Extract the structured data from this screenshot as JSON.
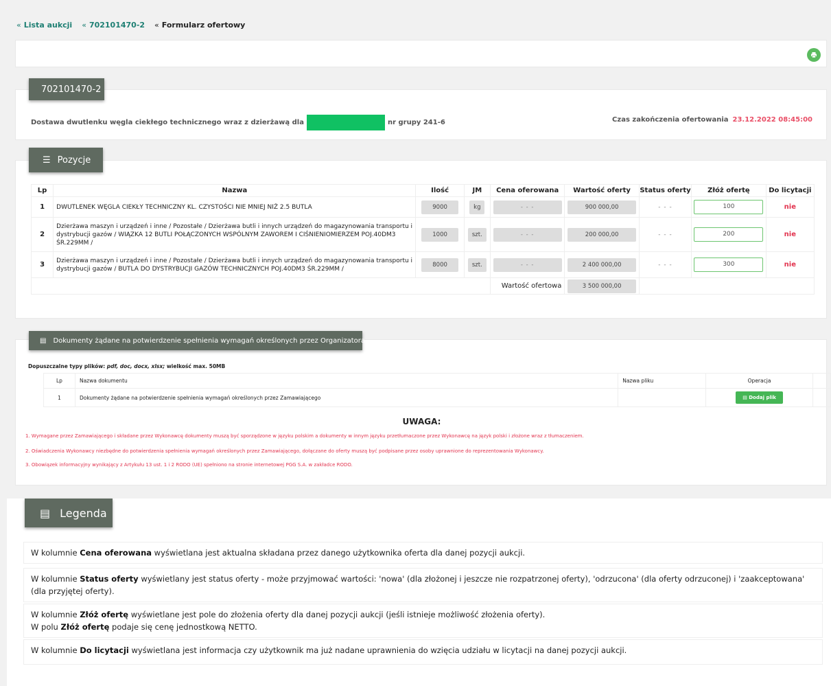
{
  "breadcrumb": [
    {
      "label": "Lista aukcji"
    },
    {
      "label": "702101470-2"
    },
    {
      "label": "Formularz ofertowy"
    }
  ],
  "toolbar": {
    "print_icon": "print-icon"
  },
  "auction": {
    "id": "702101470-2",
    "description_pre": "Dostawa dwutlenku węgla ciekłego technicznego wraz z dzierżawą dla",
    "description_post": "nr grupy 241-6",
    "deadline_label": "Czas zakończenia ofertowania",
    "deadline_value": "23.12.2022 08:45:00"
  },
  "positions": {
    "tab_label": "Pozycje",
    "columns": [
      "Lp",
      "Nazwa",
      "Ilość",
      "JM",
      "Cena oferowana",
      "Wartość oferty",
      "Status oferty",
      "Złóż ofertę",
      "Do licytacji"
    ],
    "rows": [
      {
        "lp": "1",
        "name": "DWUTLENEK WĘGLA CIEKŁY TECHNICZNY KL. CZYSTOŚCI NIE MNIEJ NIŻ 2.5 BUTLA",
        "qty": "9000",
        "unit": "kg",
        "price": "- - -",
        "value": "900 000,00",
        "status": "- - -",
        "offer": "100",
        "auction": "nie"
      },
      {
        "lp": "2",
        "name": "Dzierżawa maszyn i urządzeń i inne / Pozostałe / Dzierżawa butli i innych urządzeń do magazynowania transportu i dystrybucji gazów / WIĄZKA 12 BUTLI POŁĄCZONYCH WSPÓLNYM ZAWOREM I CIŚNIENIOMIERZEM POJ.40DM3 ŚR.229MM /",
        "qty": "1000",
        "unit": "szt.",
        "price": "- - -",
        "value": "200 000,00",
        "status": "- - -",
        "offer": "200",
        "auction": "nie"
      },
      {
        "lp": "3",
        "name": "Dzierżawa maszyn i urządzeń i inne / Pozostałe / Dzierżawa butli i innych urządzeń do magazynowania transportu i dystrybucji gazów / BUTLA DO DYSTRYBUCJI GAZÓW TECHNICZNYCH POJ.40DM3 ŚR.229MM /",
        "qty": "8000",
        "unit": "szt.",
        "price": "- - -",
        "value": "2 400 000,00",
        "status": "- - -",
        "offer": "300",
        "auction": "nie"
      }
    ],
    "total_label": "Wartość ofertowa",
    "total_value": "3 500 000,00"
  },
  "documents": {
    "tab_label": "Dokumenty żądane na potwierdzenie spełnienia wymagań określonych przez Organizatora",
    "types_prefix": "Dopuszczalne typy plików:",
    "types_list": "pdf, doc, docx, xlsx;",
    "types_suffix": "wielkość max. 50MB",
    "columns": [
      "Lp",
      "Nazwa dokumentu",
      "Nazwa pliku",
      "Operacja"
    ],
    "rows": [
      {
        "lp": "1",
        "name": "Dokumenty żądane na potwierdzenie spełnienia wymagań określonych przez Zamawiającego",
        "file": "",
        "button": "Dodaj plik"
      }
    ],
    "uwaga_title": "UWAGA:",
    "notes": [
      "1. Wymagane przez Zamawiającego i składane przez Wykonawcę dokumenty muszą być sporządzone w języku polskim a dokumenty w innym języku przetłumaczone przez Wykonawcę na język polski i złożone wraz z tłumaczeniem.",
      "2. Oświadczenia Wykonawcy niezbędne do potwierdzenia spełnienia wymagań określonych przez Zamawiającego, dołączane do oferty muszą być podpisane przez osoby uprawnione do reprezentowania Wykonawcy.",
      "3. Obowiązek informacyjny wynikający z Artykułu 13 ust. 1 i 2 RODO (UE) spełniono na stronie internetowej PGG S.A. w zakładce RODO."
    ]
  },
  "legend": {
    "tab_label": "Legenda",
    "items": [
      {
        "pre": "W kolumnie ",
        "bold": "Cena oferowana",
        "post": " wyświetlana jest aktualna składana przez danego użytkownika oferta dla danej pozycji aukcji."
      },
      {
        "pre": "W kolumnie ",
        "bold": "Status oferty",
        "post": " wyświetlany jest status oferty - może przyjmować wartości: 'nowa' (dla złożonej i jeszcze nie rozpatrzonej oferty), 'odrzucona' (dla oferty odrzuconej) i 'zaakceptowana' (dla przyjętej oferty)."
      },
      {
        "pre": "W kolumnie ",
        "bold": "Złóż ofertę",
        "post": " wyświetlane jest pole do złożenia oferty dla danej pozycji aukcji (jeśli istnieje możliwość złożenia oferty).",
        "pre2": "W polu ",
        "bold2": "Złóż ofertę",
        "post2": " podaje się cenę jednostkową NETTO."
      },
      {
        "pre": "W kolumnie ",
        "bold": "Do licytacji",
        "post": " wyświetlana jest informacja czy użytkownik ma już nadane uprawnienia do wzięcia udziału w licytacji na danej pozycji aukcji."
      }
    ]
  }
}
